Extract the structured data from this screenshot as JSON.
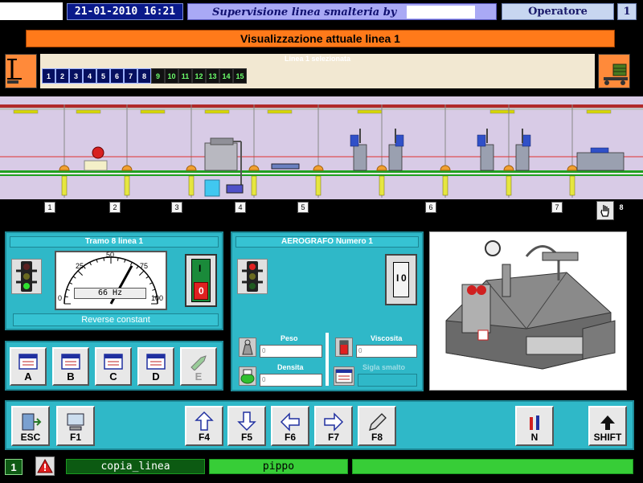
{
  "header": {
    "datetime": "21-01-2010 16:21",
    "supervision_title": "Supervisione linea smalteria by",
    "operator_label": "Operatore",
    "operator_number": "1"
  },
  "main_title": "Visualizzazione attuale linea 1",
  "line_selector": {
    "title": "Linea 1 selezionata",
    "lines": [
      {
        "label": "1",
        "active": true
      },
      {
        "label": "2",
        "active": true
      },
      {
        "label": "3",
        "active": true
      },
      {
        "label": "4",
        "active": true
      },
      {
        "label": "5",
        "active": true
      },
      {
        "label": "6",
        "active": true
      },
      {
        "label": "7",
        "active": true
      },
      {
        "label": "8",
        "active": true
      },
      {
        "label": "9",
        "active": false
      },
      {
        "label": "10",
        "active": false
      },
      {
        "label": "11",
        "active": false
      },
      {
        "label": "12",
        "active": false
      },
      {
        "label": "13",
        "active": false
      },
      {
        "label": "14",
        "active": false
      },
      {
        "label": "15",
        "active": false
      }
    ]
  },
  "stations": [
    "1",
    "2",
    "3",
    "4",
    "5",
    "6",
    "7",
    "8"
  ],
  "tramo_panel": {
    "title": "Tramo 8 linea 1",
    "gauge_ticks": [
      "0",
      "25",
      "50",
      "75",
      "100"
    ],
    "gauge_readout": "66 Hz",
    "gauge_value": 66,
    "status_text": "Reverse constant",
    "switch_labels": [
      "I",
      "0"
    ]
  },
  "aerografo_panel": {
    "title": "AEROGRAFO Numero 1",
    "switch_labels": [
      "I",
      "0"
    ],
    "fields": {
      "peso": {
        "label": "Peso",
        "value": "0"
      },
      "viscosita": {
        "label": "Viscosita",
        "value": "0"
      },
      "densita": {
        "label": "Densita",
        "value": "0"
      },
      "sigla_smalto": {
        "label": "Sigla smalto",
        "value": ""
      }
    }
  },
  "control_buttons": [
    {
      "label": "A",
      "enabled": true
    },
    {
      "label": "B",
      "enabled": true
    },
    {
      "label": "C",
      "enabled": true
    },
    {
      "label": "D",
      "enabled": true
    },
    {
      "label": "E",
      "enabled": false
    }
  ],
  "function_keys": {
    "esc": "ESC",
    "f1": "F1",
    "f4": "F4",
    "f5": "F5",
    "f6": "F6",
    "f7": "F7",
    "f8": "F8",
    "n": "N",
    "shift": "SHIFT"
  },
  "status_bar": {
    "number": "1",
    "field1": "copia_linea",
    "field2": "pippo"
  },
  "colors": {
    "panel_teal": "#2fb8c8",
    "title_orange": "#ff7a1a",
    "status_green": "#37cd37",
    "datetime_blue": "#0a1a8a"
  }
}
